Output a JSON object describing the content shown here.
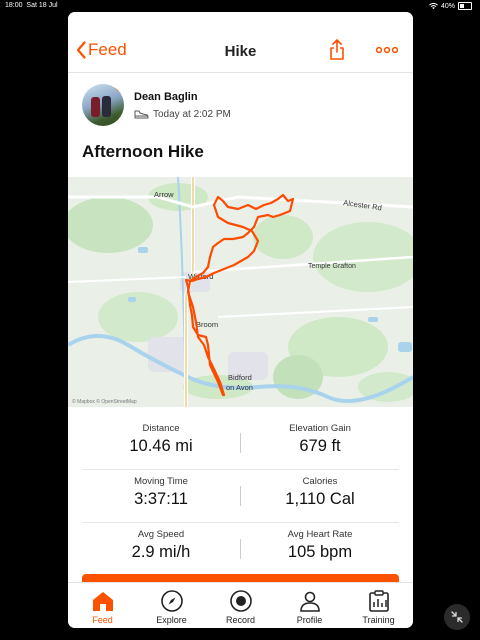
{
  "status": {
    "time": "18:00",
    "date": "Sat 18 Jul",
    "battery": "40%"
  },
  "nav": {
    "back_label": "Feed",
    "title": "Hike"
  },
  "athlete": {
    "name": "Dean Baglin",
    "time": "Today at 2:02 PM"
  },
  "activity": {
    "title": "Afternoon Hike"
  },
  "map": {
    "labels": {
      "arrow": "Arrow",
      "alcester_rd": "Alcester Rd",
      "temple_grafton": "Temple Grafton",
      "wixford": "Wixford",
      "broom": "Broom",
      "bidford": "Bidford",
      "on_avon": "on Avon",
      "attribution": "© Mapbox © OpenStreetMap"
    }
  },
  "stats": [
    {
      "left": {
        "label": "Distance",
        "value": "10.46 mi"
      },
      "right": {
        "label": "Elevation Gain",
        "value": "679 ft"
      }
    },
    {
      "left": {
        "label": "Moving Time",
        "value": "3:37:11"
      },
      "right": {
        "label": "Calories",
        "value": "1,110 Cal"
      }
    },
    {
      "left": {
        "label": "Avg Speed",
        "value": "2.9 mi/h"
      },
      "right": {
        "label": "Avg Heart Rate",
        "value": "105 bpm"
      }
    }
  ],
  "tabs": [
    {
      "label": "Feed",
      "icon": "home-icon",
      "active": true
    },
    {
      "label": "Explore",
      "icon": "compass-icon"
    },
    {
      "label": "Record",
      "icon": "record-icon"
    },
    {
      "label": "Profile",
      "icon": "profile-icon"
    },
    {
      "label": "Training",
      "icon": "training-icon"
    }
  ],
  "colors": {
    "accent": "#fc5200",
    "route": "#fc4c02",
    "map_water": "#a9d3ec",
    "map_green": "#c7e3c0"
  }
}
